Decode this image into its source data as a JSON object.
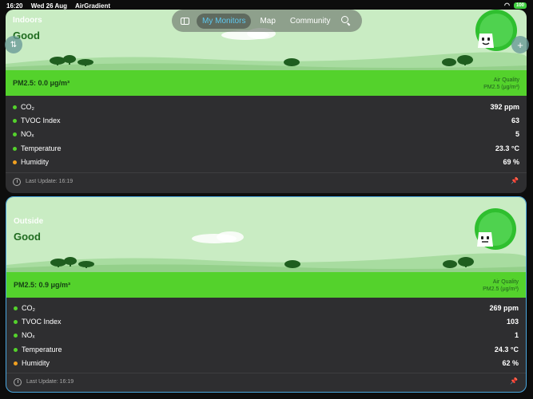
{
  "statusbar": {
    "time": "16:20",
    "date": "Wed 26 Aug",
    "app": "AirGradient",
    "battery": "100"
  },
  "nav": {
    "tabs": [
      {
        "label": "My Monitors"
      },
      {
        "label": "Map"
      },
      {
        "label": "Community"
      }
    ]
  },
  "colors": {
    "good": "#54d22c",
    "moderate": "#f0a020",
    "accent": "#4aa8e0"
  },
  "cards": [
    {
      "location": "Indoors",
      "status": "Good",
      "pm_label": "PM2.5: 0.0 μg/m³",
      "aq_line1": "Air Quality",
      "aq_line2": "PM2.5 (μg/m³)",
      "metrics": [
        {
          "name": "CO₂",
          "value": "392 ppm",
          "dot": "#54d22c"
        },
        {
          "name": "TVOC Index",
          "value": "63",
          "dot": "#54d22c"
        },
        {
          "name": "NOₓ",
          "value": "5",
          "dot": "#54d22c"
        },
        {
          "name": "Temperature",
          "value": "23.3 °C",
          "dot": "#54d22c"
        },
        {
          "name": "Humidity",
          "value": "69 %",
          "dot": "#f0a020"
        }
      ],
      "last_update": "Last Update: 16:19"
    },
    {
      "location": "Outside",
      "status": "Good",
      "pm_label": "PM2.5: 0.9 μg/m³",
      "aq_line1": "Air Quality",
      "aq_line2": "PM2.5 (μg/m³)",
      "metrics": [
        {
          "name": "CO₂",
          "value": "269 ppm",
          "dot": "#54d22c"
        },
        {
          "name": "TVOC Index",
          "value": "103",
          "dot": "#54d22c"
        },
        {
          "name": "NOₓ",
          "value": "1",
          "dot": "#54d22c"
        },
        {
          "name": "Temperature",
          "value": "24.3 °C",
          "dot": "#54d22c"
        },
        {
          "name": "Humidity",
          "value": "62 %",
          "dot": "#f0a020"
        }
      ],
      "last_update": "Last Update: 16:19"
    }
  ]
}
